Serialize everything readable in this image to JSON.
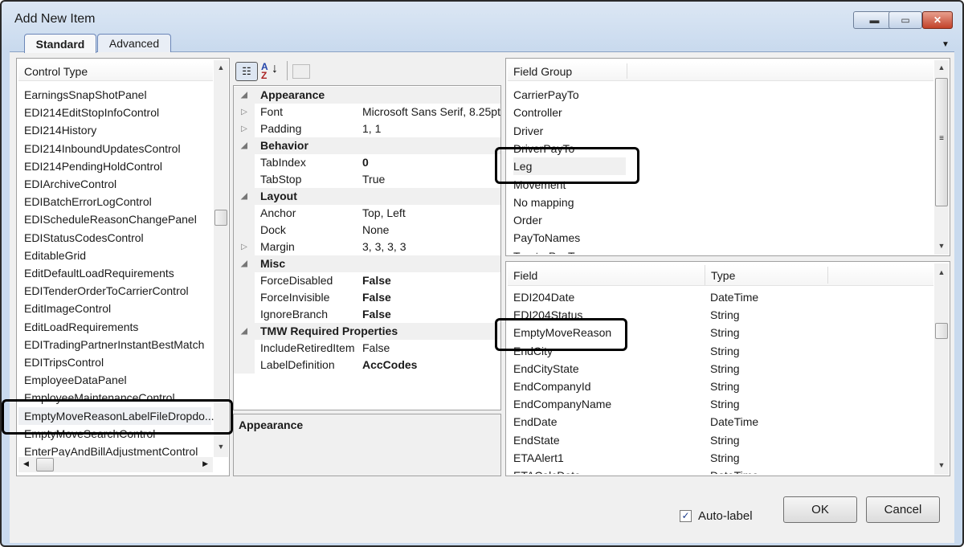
{
  "window": {
    "title": "Add New Item",
    "minimize_icon": "minimize-icon",
    "maximize_icon": "maximize-icon",
    "close_icon": "close-icon"
  },
  "tabs": [
    {
      "label": "Standard",
      "active": true
    },
    {
      "label": "Advanced",
      "active": false
    }
  ],
  "control_type": {
    "header": "Control Type",
    "items": [
      "EarningsSnapShotPanel",
      "EDI214EditStopInfoControl",
      "EDI214History",
      "EDI214InboundUpdatesControl",
      "EDI214PendingHoldControl",
      "EDIArchiveControl",
      "EDIBatchErrorLogControl",
      "EDIScheduleReasonChangePanel",
      "EDIStatusCodesControl",
      "EditableGrid",
      "EditDefaultLoadRequirements",
      "EDITenderOrderToCarrierControl",
      "EditImageControl",
      "EditLoadRequirements",
      "EDITradingPartnerInstantBestMatch",
      "EDITripsControl",
      "EmployeeDataPanel",
      "EmployeeMaintenanceControl",
      "EmptyMoveReasonLabelFileDropdo...",
      "EmptyMoveSearchControl",
      "EnterPayAndBillAdjustmentControl"
    ],
    "selected": "EmptyMoveReasonLabelFileDropdo..."
  },
  "properties": {
    "rows": [
      {
        "cat": true,
        "name": "Appearance"
      },
      {
        "name": "Font",
        "value": "Microsoft Sans Serif, 8.25pt",
        "expand": true
      },
      {
        "name": "Padding",
        "value": "1, 1",
        "expand": true
      },
      {
        "cat": true,
        "name": "Behavior"
      },
      {
        "name": "TabIndex",
        "value": "0",
        "bold": true
      },
      {
        "name": "TabStop",
        "value": "True"
      },
      {
        "cat": true,
        "name": "Layout"
      },
      {
        "name": "Anchor",
        "value": "Top, Left"
      },
      {
        "name": "Dock",
        "value": "None"
      },
      {
        "name": "Margin",
        "value": "3, 3, 3, 3",
        "expand": true
      },
      {
        "cat": true,
        "name": "Misc"
      },
      {
        "name": "ForceDisabled",
        "value": "False",
        "bold": true
      },
      {
        "name": "ForceInvisible",
        "value": "False",
        "bold": true
      },
      {
        "name": "IgnoreBranch",
        "value": "False",
        "bold": true
      },
      {
        "cat": true,
        "name": "TMW Required Properties"
      },
      {
        "name": "IncludeRetiredItem",
        "value": "False"
      },
      {
        "name": "LabelDefinition",
        "value": "AccCodes",
        "bold": true
      }
    ],
    "description": "Appearance"
  },
  "field_group": {
    "header": "Field Group",
    "items": [
      "CarrierPayTo",
      "Controller",
      "Driver",
      "DriverPayTo",
      "Leg",
      "Movement",
      "No mapping",
      "Order",
      "PayToNames",
      "TractorPayTo"
    ],
    "selected": "Leg"
  },
  "fields": {
    "headers": [
      "Field",
      "Type"
    ],
    "rows": [
      [
        "EDI204Date",
        "DateTime"
      ],
      [
        "EDI204Status",
        "String"
      ],
      [
        "EmptyMoveReason",
        "String"
      ],
      [
        "EndCity",
        "String"
      ],
      [
        "EndCityState",
        "String"
      ],
      [
        "EndCompanyId",
        "String"
      ],
      [
        "EndCompanyName",
        "String"
      ],
      [
        "EndDate",
        "DateTime"
      ],
      [
        "EndState",
        "String"
      ],
      [
        "ETAAlert1",
        "String"
      ],
      [
        "ETACalcDate",
        "DateTime"
      ]
    ],
    "selected": "EmptyMoveReason"
  },
  "footer": {
    "auto_label": "Auto-label",
    "auto_label_checked": true,
    "ok": "OK",
    "cancel": "Cancel"
  }
}
